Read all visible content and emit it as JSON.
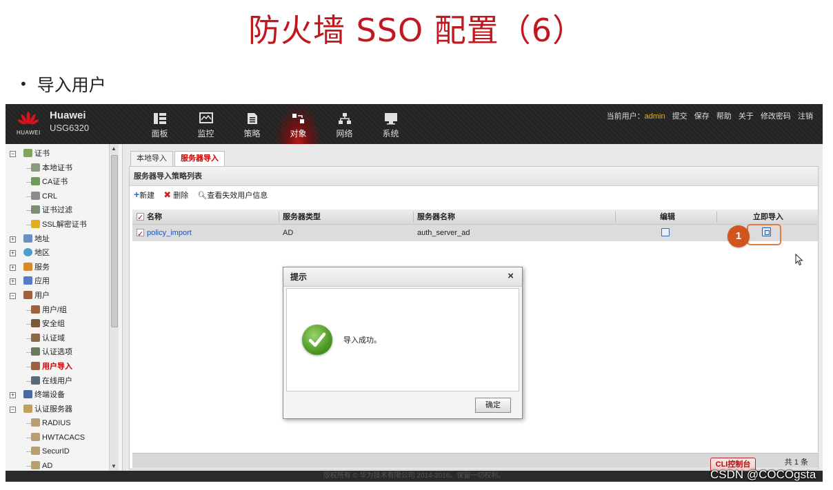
{
  "slide": {
    "title": "防火墙 SSO 配置（6）",
    "bullet": "导入用户"
  },
  "brand": {
    "logo_text": "HUAWEI",
    "name": "Huawei",
    "model": "USG6320"
  },
  "nav": [
    {
      "label": "面板",
      "icon": "dashboard-icon"
    },
    {
      "label": "监控",
      "icon": "monitor-icon"
    },
    {
      "label": "策略",
      "icon": "policy-icon"
    },
    {
      "label": "对象",
      "icon": "object-icon",
      "active": true
    },
    {
      "label": "网络",
      "icon": "network-icon"
    },
    {
      "label": "系统",
      "icon": "system-icon"
    }
  ],
  "user_bar": {
    "prefix": "当前用户：",
    "user": "admin",
    "links": [
      "提交",
      "保存",
      "帮助",
      "关于",
      "修改密码",
      "注销"
    ]
  },
  "sidebar": {
    "items": [
      {
        "label": "证书",
        "level": 0,
        "expander": "−"
      },
      {
        "label": "本地证书",
        "level": 1
      },
      {
        "label": "CA证书",
        "level": 1
      },
      {
        "label": "CRL",
        "level": 1
      },
      {
        "label": "证书过滤",
        "level": 1
      },
      {
        "label": "SSL解密证书",
        "level": 1
      },
      {
        "label": "地址",
        "level": 0,
        "expander": "+"
      },
      {
        "label": "地区",
        "level": 0,
        "expander": "+"
      },
      {
        "label": "服务",
        "level": 0,
        "expander": "+"
      },
      {
        "label": "应用",
        "level": 0,
        "expander": "+"
      },
      {
        "label": "用户",
        "level": 0,
        "expander": "−"
      },
      {
        "label": "用户/组",
        "level": 1
      },
      {
        "label": "安全组",
        "level": 1
      },
      {
        "label": "认证域",
        "level": 1
      },
      {
        "label": "认证选项",
        "level": 1
      },
      {
        "label": "用户导入",
        "level": 1,
        "selected": true
      },
      {
        "label": "在线用户",
        "level": 1
      },
      {
        "label": "终端设备",
        "level": 0,
        "expander": "+"
      },
      {
        "label": "认证服务器",
        "level": 0,
        "expander": "−"
      },
      {
        "label": "RADIUS",
        "level": 1
      },
      {
        "label": "HWTACACS",
        "level": 1
      },
      {
        "label": "SecurID",
        "level": 1
      },
      {
        "label": "AD",
        "level": 1
      }
    ]
  },
  "tabs": [
    {
      "label": "本地导入",
      "active": false
    },
    {
      "label": "服务器导入",
      "active": true
    }
  ],
  "panel": {
    "title": "服务器导入策略列表",
    "toolbar": {
      "new": "新建",
      "delete": "删除",
      "view": "查看失效用户信息"
    },
    "columns": [
      "名称",
      "服务器类型",
      "服务器名称",
      "编辑",
      "立即导入"
    ],
    "rows": [
      {
        "name": "policy_import",
        "type": "AD",
        "server": "auth_server_ad"
      }
    ],
    "total": "共 1 条"
  },
  "callout": "1",
  "dialog": {
    "title": "提示",
    "close": "×",
    "message": "导入成功。",
    "ok": "确定"
  },
  "cli_button": "CLI控制台",
  "copyright": "版权所有 © 华为技术有限公司 2014-2016。保留一切权利。",
  "watermark": "CSDN @COCOgsta",
  "colors": {
    "title_red": "#c0181f",
    "topbar": "#232323",
    "accent_red": "#b41a1a",
    "badge": "#d2541f"
  }
}
